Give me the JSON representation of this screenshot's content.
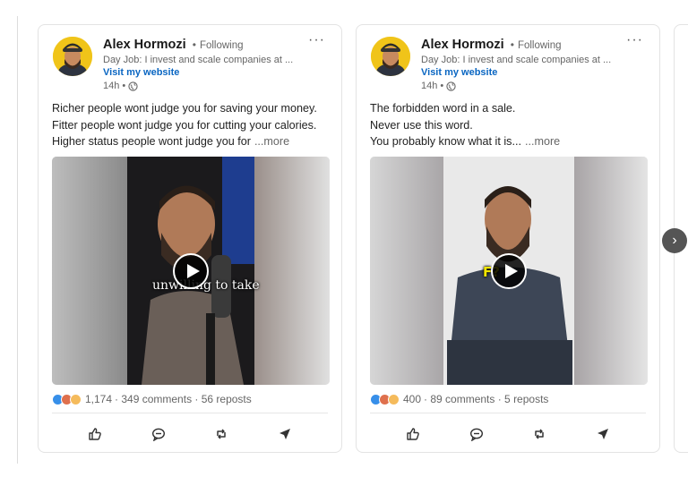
{
  "posts": [
    {
      "author": "Alex Hormozi",
      "separator": "•",
      "follow_status": "Following",
      "headline": "Day Job: I invest and scale companies at ...",
      "website": "Visit my website",
      "time": "14h •",
      "more_menu": "···",
      "text_lines": [
        "Richer people wont judge you for saving your money.",
        "Fitter people wont judge you for cutting your calories.",
        "Higher status people wont judge you for"
      ],
      "see_more": "...more",
      "video_caption": "unwilling to take",
      "reactions_count": "1,174",
      "comments_reposts": "· 349 comments · 56 reposts"
    },
    {
      "author": "Alex Hormozi",
      "separator": "•",
      "follow_status": "Following",
      "headline": "Day Job: I invest and scale companies at ...",
      "website": "Visit my website",
      "time": "14h •",
      "more_menu": "···",
      "text_lines": [
        "The forbidden word in a sale.",
        "Never use this word.",
        "You probably know what it is..."
      ],
      "see_more": "...more",
      "video_caption": "F?",
      "reactions_count": "400",
      "comments_reposts": "· 89 comments · 5 reposts"
    }
  ],
  "next_button": "›",
  "icons": {
    "like": "thumbs-up-icon",
    "comment": "comment-icon",
    "repost": "repost-icon",
    "send": "send-icon",
    "globe": "globe-icon",
    "play": "play-icon"
  },
  "colors": {
    "link": "#0a66c2",
    "like_reaction": "#378fe9",
    "love_reaction": "#df704d",
    "insight_reaction": "#f5bb5c"
  }
}
